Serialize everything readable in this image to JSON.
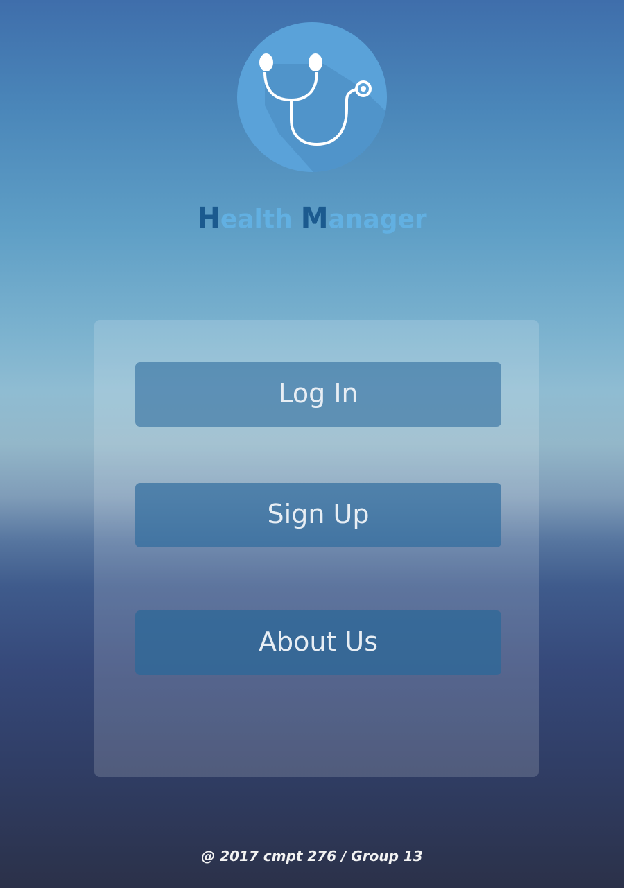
{
  "app": {
    "brand_first_initial": "H",
    "brand_first_rest": "ealth",
    "brand_second_initial": "M",
    "brand_second_rest": "anager",
    "logo_icon": "stethoscope-icon"
  },
  "menu": {
    "login_label": "Log In",
    "signup_label": "Sign Up",
    "about_label": "About Us"
  },
  "footer": {
    "text": "@ 2017 cmpt 276 / Group 13"
  },
  "colors": {
    "brand_dark": "#1b5a8f",
    "brand_light": "#62b0e2",
    "button_text": "#e8eef4"
  }
}
